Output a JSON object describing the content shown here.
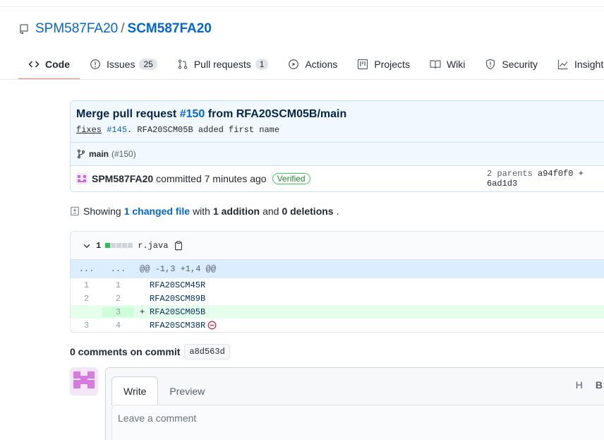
{
  "repo": {
    "owner": "SPM587FA20",
    "separator": "/",
    "name": "SCM587FA20"
  },
  "tabs": [
    {
      "label": "Code",
      "icon": "code-icon",
      "selected": true
    },
    {
      "label": "Issues",
      "count": "25",
      "icon": "issue-icon"
    },
    {
      "label": "Pull requests",
      "count": "1",
      "icon": "pull-request-icon"
    },
    {
      "label": "Actions",
      "icon": "play-icon"
    },
    {
      "label": "Projects",
      "icon": "project-icon"
    },
    {
      "label": "Wiki",
      "icon": "book-icon"
    },
    {
      "label": "Security",
      "icon": "shield-icon"
    },
    {
      "label": "Insights",
      "icon": "graph-icon"
    }
  ],
  "commit": {
    "title_prefix": "Merge pull request ",
    "pr_link": "#150",
    "title_suffix": " from RFA20SCM05B/main",
    "desc_fixes": "fixes",
    "desc_issue": "#145",
    "desc_rest": ". RFA20SCM05B added first name",
    "branch": "main",
    "branch_pr": "(#150)",
    "author": "SPM587FA20",
    "committed_text": "committed 7 minutes ago",
    "verified": "Verified",
    "parents_label": "2 parents",
    "parents_sha": "a94f0f0 + 6ad1d3"
  },
  "summary": {
    "prefix": "Showing",
    "changed": "1 changed file",
    "with": "with",
    "additions": "1 addition",
    "and": "and",
    "deletions": "0 deletions",
    "end": "."
  },
  "file": {
    "count": "1",
    "name": "r.java",
    "hunk_left": "...",
    "hunk_right": "...",
    "hunk_header": "@@ -1,3 +1,4 @@",
    "lines": [
      {
        "old": "1",
        "new": "1",
        "marker": "",
        "text": "RFA20SCM45R",
        "type": "ctx"
      },
      {
        "old": "2",
        "new": "2",
        "marker": "",
        "text": "RFA20SCM89B",
        "type": "ctx"
      },
      {
        "old": "",
        "new": "3",
        "marker": "+",
        "text": "RFA20SCM05B",
        "type": "add"
      },
      {
        "old": "3",
        "new": "4",
        "marker": "",
        "text": "RFA20SCM38R",
        "type": "ctx"
      }
    ]
  },
  "comments": {
    "title": "0 comments on commit",
    "sha": "a8d563d"
  },
  "editor": {
    "tab_write": "Write",
    "tab_preview": "Preview",
    "tool_h": "H",
    "tool_b": "B",
    "placeholder": "Leave a comment"
  },
  "colors": {
    "link": "#0366d6",
    "tab_underline": "#f9826c",
    "add_bg": "#e6ffed",
    "verified": "#22863a"
  }
}
